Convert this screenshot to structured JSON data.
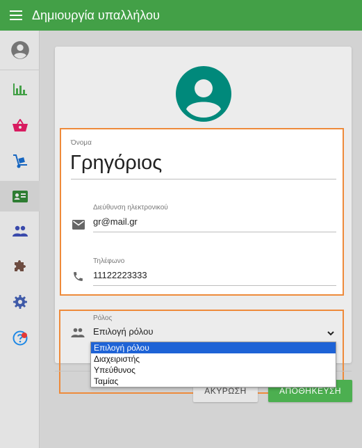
{
  "appbar": {
    "title": "Δημιουργία υπαλλήλου",
    "menu_icon": "hamburger-menu-icon"
  },
  "sidebar": {
    "items": [
      {
        "icon": "account-circle-icon",
        "color": "#757575"
      },
      {
        "icon": "bar-chart-icon",
        "color": "#43a047"
      },
      {
        "icon": "shopping-basket-icon",
        "color": "#d81b60"
      },
      {
        "icon": "hand-truck-icon",
        "color": "#1565c0"
      },
      {
        "icon": "badge-card-icon",
        "color": "#2e7d32",
        "active": true
      },
      {
        "icon": "people-icon",
        "color": "#3949ab"
      },
      {
        "icon": "puzzle-icon",
        "color": "#6d4c41"
      },
      {
        "icon": "gear-icon",
        "color": "#3f5aa8"
      },
      {
        "icon": "help-icon",
        "color": "#1e88e5",
        "badge": true
      }
    ]
  },
  "form": {
    "name": {
      "label": "Όνομα",
      "value": "Γρηγόριος"
    },
    "email": {
      "label": "Διεύθυνση ηλεκτρονικού",
      "value": "gr@mail.gr"
    },
    "phone": {
      "label": "Τηλέφωνο",
      "value": "11122223333"
    },
    "role": {
      "label": "Ρόλος",
      "value": "Επιλογή ρόλου",
      "options": [
        "Επιλογή ρόλου",
        "Διαχειριστής",
        "Υπεύθυνος",
        "Ταμίας"
      ],
      "selected_index": 0
    }
  },
  "buttons": {
    "cancel": "ΑΚΥΡΩΣΗ",
    "save": "ΑΠΟΘΗΚΕΥΣΗ"
  },
  "colors": {
    "appbar": "#43a047",
    "avatar": "#00897b",
    "highlight": "#ee8a3a",
    "selected_option": "#1e63d6"
  }
}
